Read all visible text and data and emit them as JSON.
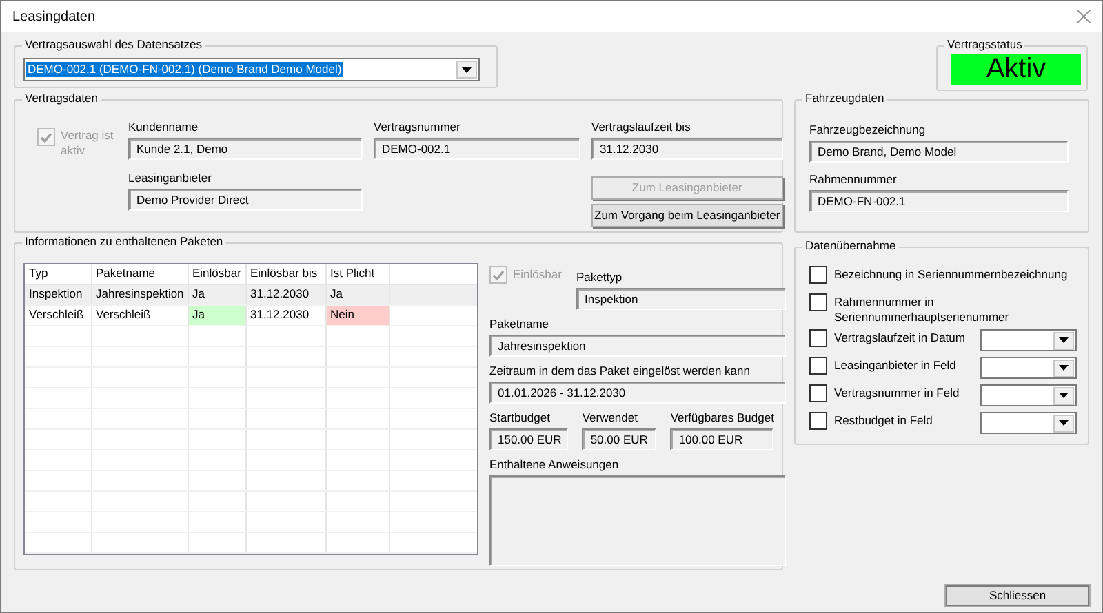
{
  "window": {
    "title": "Leasingdaten"
  },
  "contract_selection": {
    "title": "Vertragsauswahl des Datensatzes",
    "value": "DEMO-002.1 (DEMO-FN-002.1) (Demo Brand Demo Model)"
  },
  "contract_status": {
    "title": "Vertragsstatus",
    "value": "Aktiv",
    "active": true
  },
  "contract_data": {
    "title": "Vertragsdaten",
    "active_checkbox": {
      "label": "Vertrag ist aktiv",
      "checked": true,
      "disabled": true
    },
    "fields": [
      {
        "label": "Kundenname",
        "value": "Kunde 2.1, Demo"
      },
      {
        "label": "Vertragsnummer",
        "value": "DEMO-002.1"
      },
      {
        "label": "Vertragslaufzeit bis",
        "value": "31.12.2030"
      },
      {
        "label": "Leasinganbieter",
        "value": "Demo Provider Direct"
      }
    ],
    "buttons": [
      {
        "label": "Zum Leasinganbieter",
        "disabled": true
      },
      {
        "label": "Zum Vorgang beim Leasinganbieter",
        "disabled": false
      }
    ]
  },
  "vehicle_data": {
    "title": "Fahrzeugdaten",
    "fields": [
      {
        "label": "Fahrzeugbezeichnung",
        "value": "Demo Brand, Demo Model"
      },
      {
        "label": "Rahmennummer",
        "value": "DEMO-FN-002.1"
      }
    ]
  },
  "packages": {
    "title": "Informationen zu enthaltenen Paketen",
    "table": {
      "columns": [
        "Typ",
        "Paketname",
        "Einlösbar",
        "Einlösbar bis",
        "Ist Plicht"
      ],
      "rows": [
        {
          "selected": true,
          "cells": [
            {
              "text": "Inspektion"
            },
            {
              "text": "Jahresinspektion"
            },
            {
              "text": "Ja"
            },
            {
              "text": "31.12.2030"
            },
            {
              "text": "Ja"
            }
          ]
        },
        {
          "selected": false,
          "cells": [
            {
              "text": "Verschleiß"
            },
            {
              "text": "Verschleiß"
            },
            {
              "text": "Ja",
              "color": "#ccffcc"
            },
            {
              "text": "31.12.2030"
            },
            {
              "text": "Nein",
              "color": "#ffcccc"
            }
          ]
        }
      ]
    },
    "detail": {
      "redeemable": {
        "label": "Einlösbar",
        "checked": true,
        "disabled": true
      },
      "fields": [
        {
          "label": "Pakettyp",
          "value": "Inspektion"
        },
        {
          "label": "Paketname",
          "value": "Jahresinspektion"
        },
        {
          "label": "Zeitraum in dem das Paket eingelöst werden kann",
          "value": "01.01.2026 - 31.12.2030"
        },
        {
          "label": "Startbudget",
          "value": "150.00 EUR"
        },
        {
          "label": "Verwendet",
          "value": "50.00 EUR"
        },
        {
          "label": "Verfügbares Budget",
          "value": "100.00 EUR"
        }
      ],
      "instructions": {
        "label": "Enthaltene Anweisungen"
      }
    }
  },
  "data_transfer": {
    "title": "Datenübernahme",
    "options": [
      {
        "kind": "checkbox",
        "label": "Bezeichnung in Seriennummernbezeichnung",
        "checked": false
      },
      {
        "kind": "checkbox",
        "label": "Rahmennummer in Seriennummerhauptserienummer",
        "checked": false
      },
      {
        "kind": "dropdown",
        "label": "Vertragslaufzeit in Datum",
        "checked": false
      },
      {
        "kind": "dropdown",
        "label": "Leasinganbieter in Feld",
        "checked": false
      },
      {
        "kind": "dropdown",
        "label": "Vertragsnummer in Feld",
        "checked": false
      },
      {
        "kind": "dropdown",
        "label": "Restbudget in Feld",
        "checked": false
      }
    ]
  },
  "close_button": {
    "label": "Schliessen"
  }
}
